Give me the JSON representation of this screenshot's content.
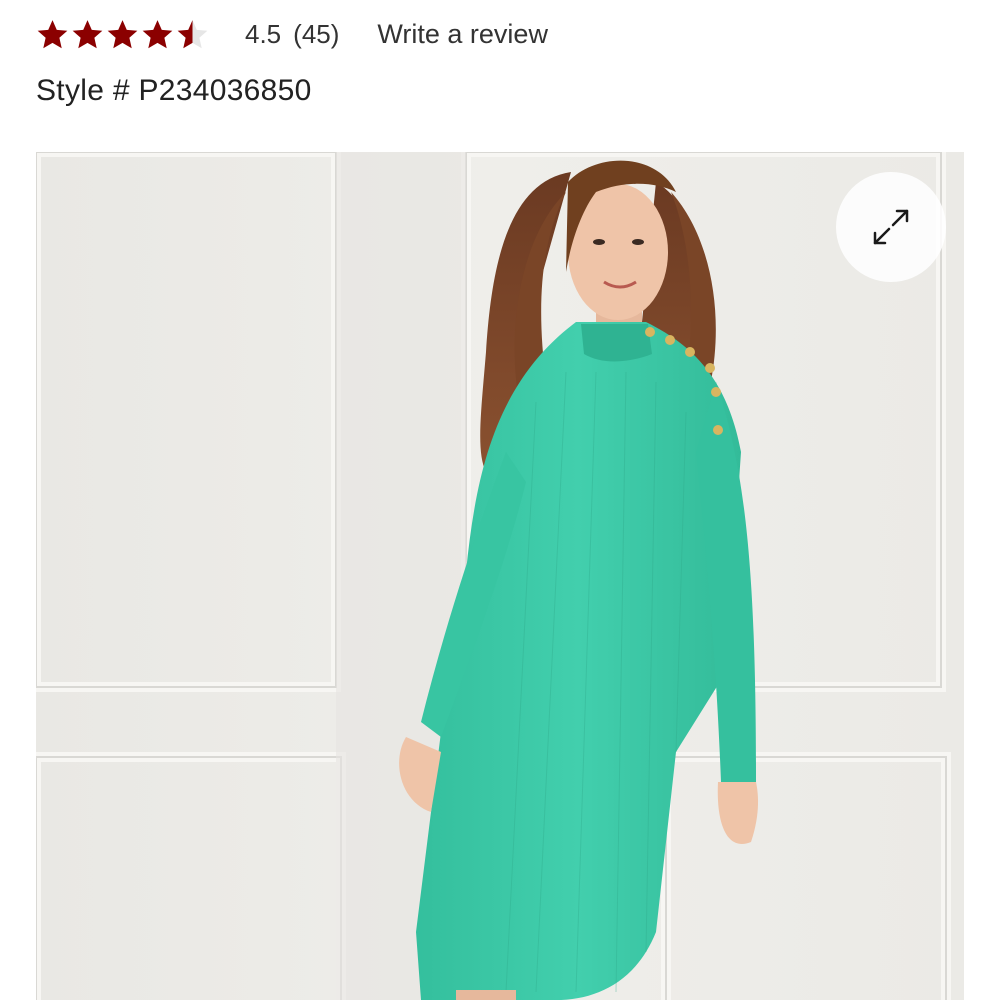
{
  "rating": {
    "value": "4.5",
    "count": "(45)",
    "stars_filled": 4.5,
    "stars_total": 5,
    "star_color": "#8b0000",
    "write_review_label": "Write a review"
  },
  "product": {
    "style_number": "Style # P234036850",
    "image_alt": "Woman wearing a mint green ribbed mock-neck sweater dress with gold shoulder buttons",
    "dress_color": "#3cc8a6",
    "expand_icon": "expand-arrows-icon"
  }
}
